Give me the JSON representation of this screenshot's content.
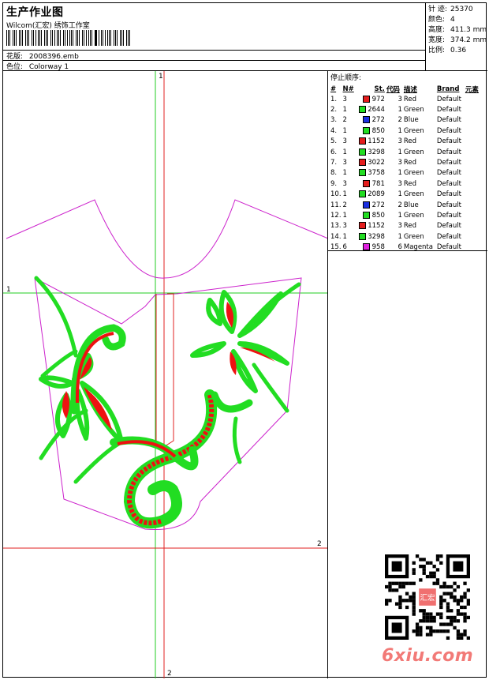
{
  "header": {
    "title": "生产作业图",
    "company": "Wilcom(汇宏) 绣饰工作室",
    "design_label": "花版:",
    "design_value": "2008396.emb",
    "colorway_label": "色位:",
    "colorway_value": "Colorway 1"
  },
  "stats": [
    {
      "label": "针 迹:",
      "value": "25370"
    },
    {
      "label": "颜色:",
      "value": "4"
    },
    {
      "label": "高度:",
      "value": "411.3 mm"
    },
    {
      "label": "宽度:",
      "value": "374.2 mm"
    },
    {
      "label": "比例:",
      "value": "0.36"
    }
  ],
  "sequence": {
    "title": "停止顺序:",
    "headers": [
      "#",
      "N#",
      "St.",
      "代码",
      "描述",
      "Brand",
      "元素"
    ],
    "rows": [
      {
        "idx": "1.",
        "n": "3",
        "color": "#e41d1d",
        "st": "972",
        "code": "3",
        "desc": "Red",
        "brand": "Default"
      },
      {
        "idx": "2.",
        "n": "1",
        "color": "#22dd22",
        "st": "2644",
        "code": "1",
        "desc": "Green",
        "brand": "Default"
      },
      {
        "idx": "3.",
        "n": "2",
        "color": "#1b2fe0",
        "st": "272",
        "code": "2",
        "desc": "Blue",
        "brand": "Default"
      },
      {
        "idx": "4.",
        "n": "1",
        "color": "#22dd22",
        "st": "850",
        "code": "1",
        "desc": "Green",
        "brand": "Default"
      },
      {
        "idx": "5.",
        "n": "3",
        "color": "#e41d1d",
        "st": "1152",
        "code": "3",
        "desc": "Red",
        "brand": "Default"
      },
      {
        "idx": "6.",
        "n": "1",
        "color": "#22dd22",
        "st": "3298",
        "code": "1",
        "desc": "Green",
        "brand": "Default"
      },
      {
        "idx": "7.",
        "n": "3",
        "color": "#e41d1d",
        "st": "3022",
        "code": "3",
        "desc": "Red",
        "brand": "Default"
      },
      {
        "idx": "8.",
        "n": "1",
        "color": "#22dd22",
        "st": "3758",
        "code": "1",
        "desc": "Green",
        "brand": "Default"
      },
      {
        "idx": "9.",
        "n": "3",
        "color": "#e41d1d",
        "st": "781",
        "code": "3",
        "desc": "Red",
        "brand": "Default"
      },
      {
        "idx": "10.",
        "n": "1",
        "color": "#22dd22",
        "st": "2089",
        "code": "1",
        "desc": "Green",
        "brand": "Default"
      },
      {
        "idx": "11.",
        "n": "2",
        "color": "#1b2fe0",
        "st": "272",
        "code": "2",
        "desc": "Blue",
        "brand": "Default"
      },
      {
        "idx": "12.",
        "n": "1",
        "color": "#22dd22",
        "st": "850",
        "code": "1",
        "desc": "Green",
        "brand": "Default"
      },
      {
        "idx": "13.",
        "n": "3",
        "color": "#e41d1d",
        "st": "1152",
        "code": "3",
        "desc": "Red",
        "brand": "Default"
      },
      {
        "idx": "14.",
        "n": "1",
        "color": "#22dd22",
        "st": "3298",
        "code": "1",
        "desc": "Green",
        "brand": "Default"
      },
      {
        "idx": "15.",
        "n": "6",
        "color": "#e020e0",
        "st": "958",
        "code": "6",
        "desc": "Magenta",
        "brand": "Default"
      }
    ]
  },
  "markers": {
    "top_1": "1",
    "left_1": "1",
    "right_2": "2",
    "bottom_2": "2"
  },
  "qr_stamp_text": "汇宏",
  "watermark": "6xiu.com",
  "colors": {
    "guide_green": "#22cc22",
    "guide_red": "#e02020",
    "outline_magenta": "#cc22cc",
    "fill_green": "#11ee11",
    "fill_red": "#ee1111"
  }
}
